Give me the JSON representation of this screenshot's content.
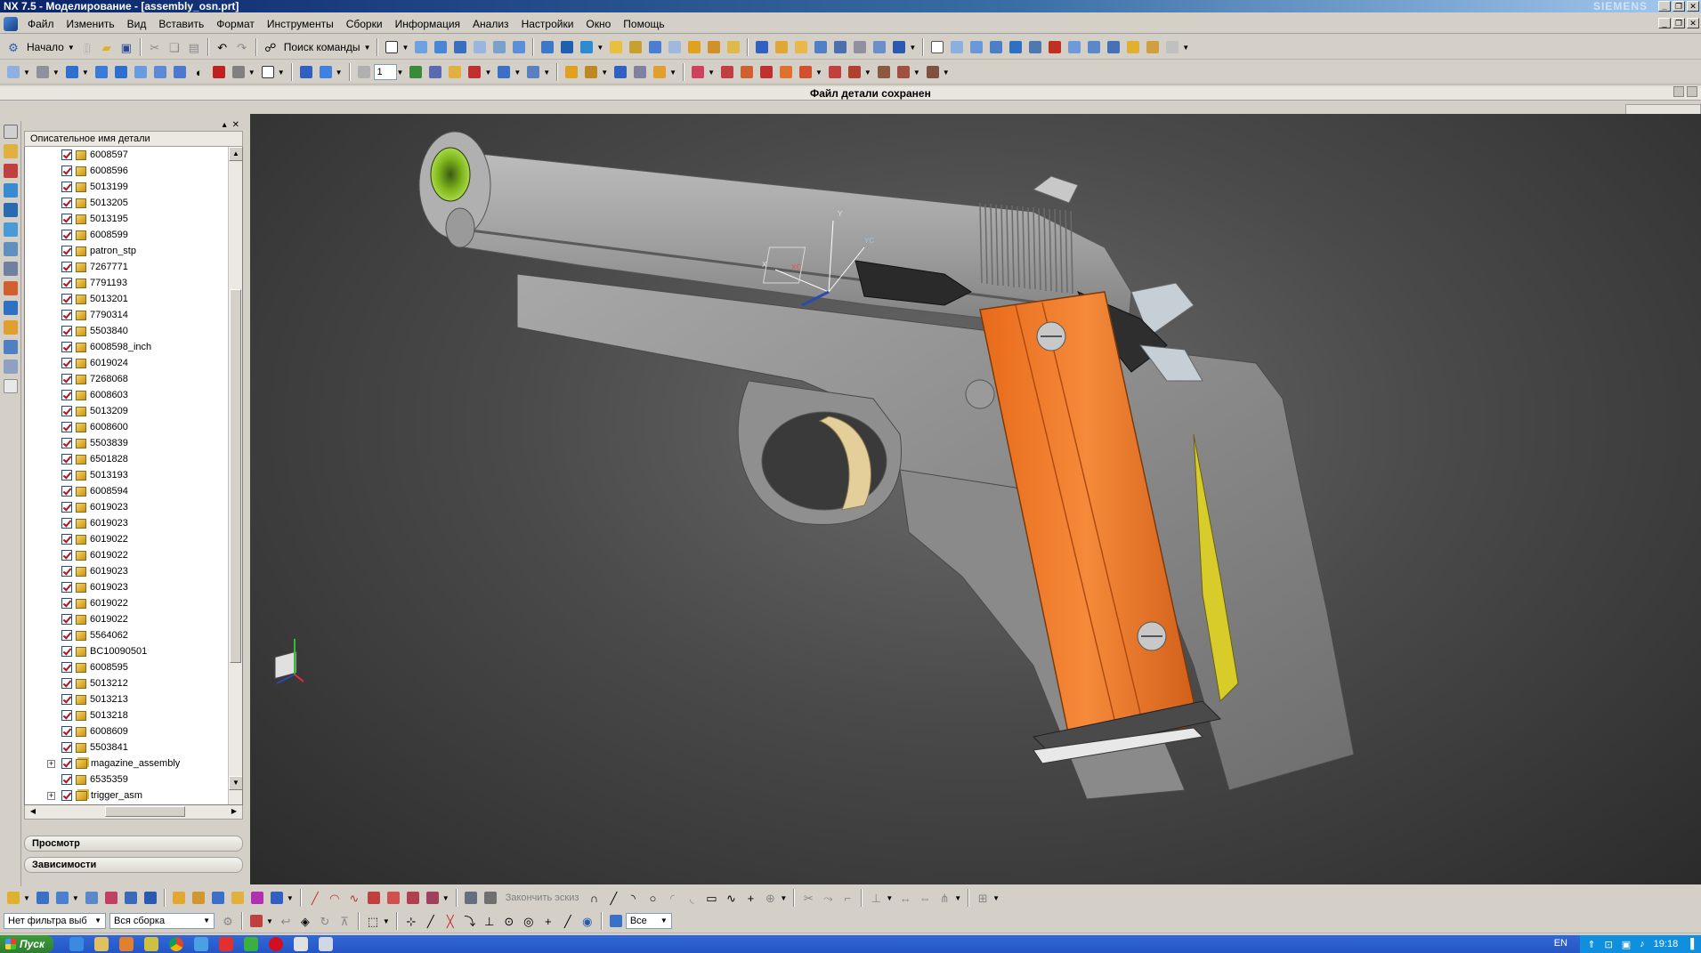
{
  "window": {
    "title": "NX 7.5 - Моделирование - [assembly_osn.prt]",
    "brand": "SIEMENS"
  },
  "menu": [
    "Файл",
    "Изменить",
    "Вид",
    "Вставить",
    "Формат",
    "Инструменты",
    "Сборки",
    "Информация",
    "Анализ",
    "Настройки",
    "Окно",
    "Помощь"
  ],
  "toolbar": {
    "start_label": "Начало",
    "command_search_label": "Поиск команды",
    "layer_value": "1"
  },
  "status": {
    "message": "Файл детали сохранен"
  },
  "navigator": {
    "column_header": "Описательное имя детали",
    "items": [
      {
        "name": "6008597",
        "type": "part"
      },
      {
        "name": "6008596",
        "type": "part"
      },
      {
        "name": "5013199",
        "type": "part"
      },
      {
        "name": "5013205",
        "type": "part"
      },
      {
        "name": "5013195",
        "type": "part"
      },
      {
        "name": "6008599",
        "type": "part"
      },
      {
        "name": "patron_stp",
        "type": "part"
      },
      {
        "name": "7267771",
        "type": "part"
      },
      {
        "name": "7791193",
        "type": "part"
      },
      {
        "name": "5013201",
        "type": "part"
      },
      {
        "name": "7790314",
        "type": "part"
      },
      {
        "name": "5503840",
        "type": "part"
      },
      {
        "name": "6008598_inch",
        "type": "part"
      },
      {
        "name": "6019024",
        "type": "part"
      },
      {
        "name": "7268068",
        "type": "part"
      },
      {
        "name": "6008603",
        "type": "part"
      },
      {
        "name": "5013209",
        "type": "part"
      },
      {
        "name": "6008600",
        "type": "part"
      },
      {
        "name": "5503839",
        "type": "part"
      },
      {
        "name": "6501828",
        "type": "part"
      },
      {
        "name": "5013193",
        "type": "part"
      },
      {
        "name": "6008594",
        "type": "part"
      },
      {
        "name": "6019023",
        "type": "part"
      },
      {
        "name": "6019023",
        "type": "part"
      },
      {
        "name": "6019022",
        "type": "part"
      },
      {
        "name": "6019022",
        "type": "part"
      },
      {
        "name": "6019023",
        "type": "part"
      },
      {
        "name": "6019023",
        "type": "part"
      },
      {
        "name": "6019022",
        "type": "part"
      },
      {
        "name": "6019022",
        "type": "part"
      },
      {
        "name": "5564062",
        "type": "part"
      },
      {
        "name": "BC10090501",
        "type": "part"
      },
      {
        "name": "6008595",
        "type": "part"
      },
      {
        "name": "5013212",
        "type": "part"
      },
      {
        "name": "5013213",
        "type": "part"
      },
      {
        "name": "5013218",
        "type": "part"
      },
      {
        "name": "6008609",
        "type": "part"
      },
      {
        "name": "5503841",
        "type": "part"
      },
      {
        "name": "magazine_assembly",
        "type": "assembly"
      },
      {
        "name": "6535359",
        "type": "part"
      },
      {
        "name": "trigger_asm",
        "type": "assembly"
      }
    ],
    "sections": [
      "Просмотр",
      "Зависимости"
    ]
  },
  "bottom_toolbar": {
    "finish_sketch_label": "Закончить эскиз",
    "filter_value": "Нет фильтра выб",
    "scope_value": "Вся сборка",
    "snap_value": "Все"
  },
  "taskbar": {
    "start_label": "Пуск",
    "lang": "EN",
    "clock": "19:18"
  },
  "colors": {
    "grip": "#f07a2a",
    "barrel_bushing": "#7fb51c",
    "trigger": "#e4cf9a",
    "frame": "#a0a0a0",
    "slide": "#9c9c9c",
    "background": "#4a4a4a"
  }
}
